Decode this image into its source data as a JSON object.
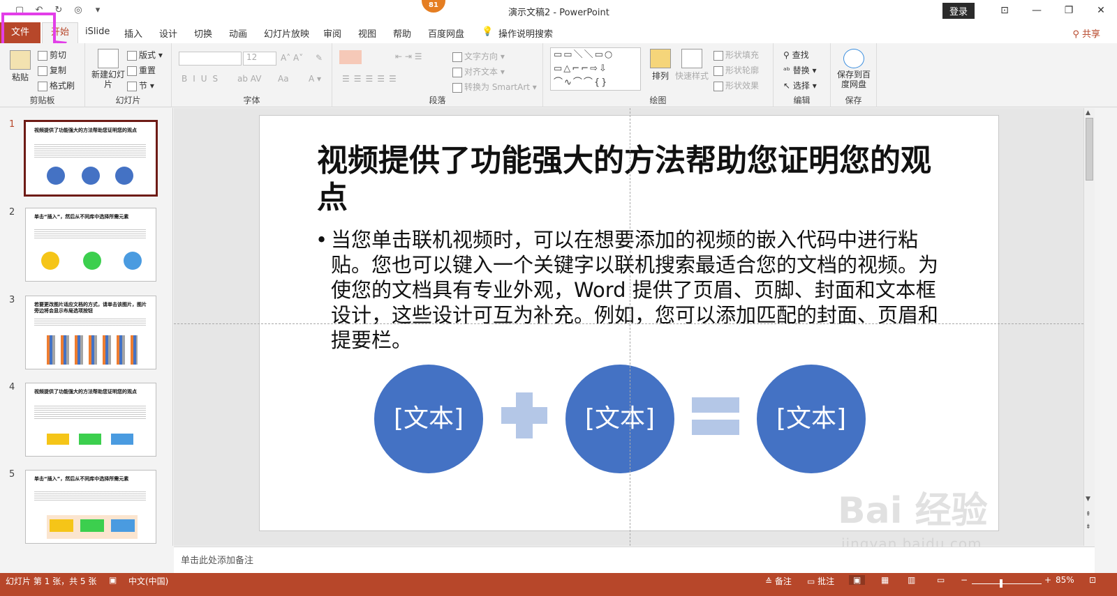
{
  "window": {
    "doc_title": "演示文稿2  -  PowerPoint",
    "badge": "81",
    "login": "登录"
  },
  "tabs": {
    "file": "文件",
    "home": "开始",
    "items": [
      "iSlide",
      "插入",
      "设计",
      "切换",
      "动画",
      "幻灯片放映",
      "审阅",
      "视图",
      "帮助",
      "百度网盘"
    ],
    "tell_me": "操作说明搜索",
    "share": "共享"
  },
  "ribbon": {
    "clipboard": {
      "label": "剪贴板",
      "paste": "粘贴",
      "cut": "剪切",
      "copy": "复制",
      "format_painter": "格式刷"
    },
    "slides": {
      "label": "幻灯片",
      "new_slide": "新建幻灯片",
      "layout": "版式",
      "reset": "重置",
      "section": "节"
    },
    "font": {
      "label": "字体",
      "size": "12",
      "aa": "Aa"
    },
    "paragraph": {
      "label": "段落",
      "text_direction": "文字方向",
      "align_text": "对齐文本",
      "smartart": "转换为 SmartArt"
    },
    "drawing": {
      "label": "绘图",
      "arrange": "排列",
      "quick_styles": "快速样式",
      "shape_fill": "形状填充",
      "shape_outline": "形状轮廓",
      "shape_effects": "形状效果"
    },
    "editing": {
      "label": "编辑",
      "find": "查找",
      "replace": "替换",
      "select": "选择"
    },
    "save": {
      "label": "保存",
      "save_to_baidu": "保存到百度网盘"
    }
  },
  "thumbnails": [
    {
      "num": "1",
      "title": "视频提供了功能强大的方法帮助您证明您的观点"
    },
    {
      "num": "2",
      "title": "单击“插入”，然后从不同库中选择所需元素"
    },
    {
      "num": "3",
      "title": "若要更改图片适应文档的方式，请单击该图片，图片旁边将会显示布局选项按钮"
    },
    {
      "num": "4",
      "title": "视频提供了功能强大的方法帮助您证明您的观点"
    },
    {
      "num": "5",
      "title": "单击“插入”，然后从不同库中选择所需元素"
    }
  ],
  "slide": {
    "title": "视频提供了功能强大的方法帮助您证明您的观点",
    "body": "当您单击联机视频时，可以在想要添加的视频的嵌入代码中进行粘贴。您也可以键入一个关键字以联机搜索最适合您的文档的视频。为使您的文档具有专业外观，Word 提供了页眉、页脚、封面和文本框设计，这些设计可互为补充。例如，您可以添加匹配的封面、页眉和提要栏。",
    "circle1": "[文本]",
    "circle2": "[文本]",
    "circle3": "[文本]"
  },
  "notes": {
    "placeholder": "单击此处添加备注"
  },
  "status": {
    "slide_info": "幻灯片 第 1 张，共 5 张",
    "language": "中文(中国)",
    "notes": "备注",
    "comments": "批注",
    "zoom": "85%"
  },
  "watermark": {
    "text": "Bai 经验",
    "url": "jingyan.baidu.com"
  },
  "colors": {
    "accent": "#b7472a",
    "shape_blue": "#4472c4",
    "shape_light": "#b4c7e7",
    "highlight": "#e23ee8"
  }
}
